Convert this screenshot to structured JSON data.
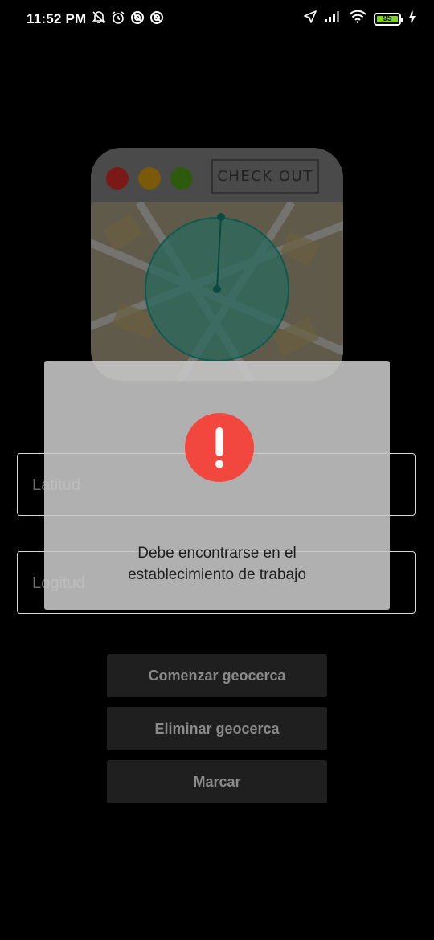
{
  "status_bar": {
    "time": "11:52 PM",
    "battery": "95",
    "left_icons": [
      "mute-bell-icon",
      "alarm-icon",
      "data-saver-icon",
      "data-saver-icon"
    ],
    "right_icons": [
      "location-arrow-icon",
      "signal-icon",
      "wifi-icon",
      "battery-icon",
      "charging-icon"
    ]
  },
  "illustration": {
    "check_out_label": "CHECK OUT",
    "window_dots": [
      "#ff3b30",
      "#ffcc00",
      "#4cd964"
    ]
  },
  "form": {
    "latitude_placeholder": "Latitud",
    "longitude_placeholder": "Logitud"
  },
  "buttons": {
    "start_geofence": "Comenzar geocerca",
    "remove_geofence": "Eliminar geocerca",
    "mark": "Marcar"
  },
  "alert": {
    "icon": "exclamation-icon",
    "message_line1": "Debe encontrarse en el",
    "message_line2": "establecimiento de trabajo",
    "icon_color": "#f2473f"
  }
}
